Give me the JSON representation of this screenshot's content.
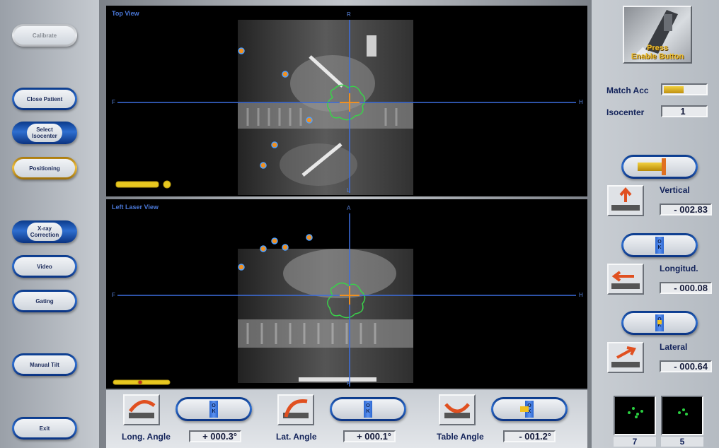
{
  "left_buttons": [
    {
      "label": "Calibrate",
      "state": "disabled"
    },
    {
      "label": "Close Patient",
      "state": "normal"
    },
    {
      "label": "Select Isocenter",
      "state": "normal"
    },
    {
      "label": "Positioning",
      "state": "active"
    },
    {
      "label": "X-ray Correction",
      "state": "normal"
    },
    {
      "label": "Video",
      "state": "normal"
    },
    {
      "label": "Gating",
      "state": "normal"
    },
    {
      "label": "Manual Tilt",
      "state": "normal"
    },
    {
      "label": "Exit",
      "state": "normal"
    }
  ],
  "top_view": {
    "title": "Top View",
    "labels": {
      "top": "R",
      "left": "F",
      "right": "H",
      "bottom": "L"
    }
  },
  "left_view": {
    "title": "Left Laser View",
    "labels": {
      "top": "A",
      "left": "F",
      "right": "H",
      "bottom": "P"
    }
  },
  "enable_button": {
    "line1": "Press",
    "line2": "Enable Button"
  },
  "match_acc": {
    "label": "Match Acc"
  },
  "isocenter": {
    "label": "Isocenter",
    "value": "1"
  },
  "ok_text": "OK",
  "vertical": {
    "label": "Vertical",
    "value": "- 002.83"
  },
  "longitud": {
    "label": "Longitud.",
    "value": "- 000.08"
  },
  "lateral": {
    "label": "Lateral",
    "value": "- 000.64"
  },
  "bottom": {
    "long_angle": {
      "label": "Long. Angle",
      "value": "+ 000.3°"
    },
    "lat_angle": {
      "label": "Lat. Angle",
      "value": "+ 000.1°"
    },
    "table_angle": {
      "label": "Table Angle",
      "value": "- 001.2°"
    }
  },
  "mini_views": [
    {
      "number": "7"
    },
    {
      "number": "5"
    }
  ],
  "colors": {
    "accent_blue": "#2f6fd0",
    "active_gold": "#f0c040",
    "crosshair": "#3d6fe0",
    "target_contour": "#3ad14a",
    "marker_orange": "#f09020"
  }
}
